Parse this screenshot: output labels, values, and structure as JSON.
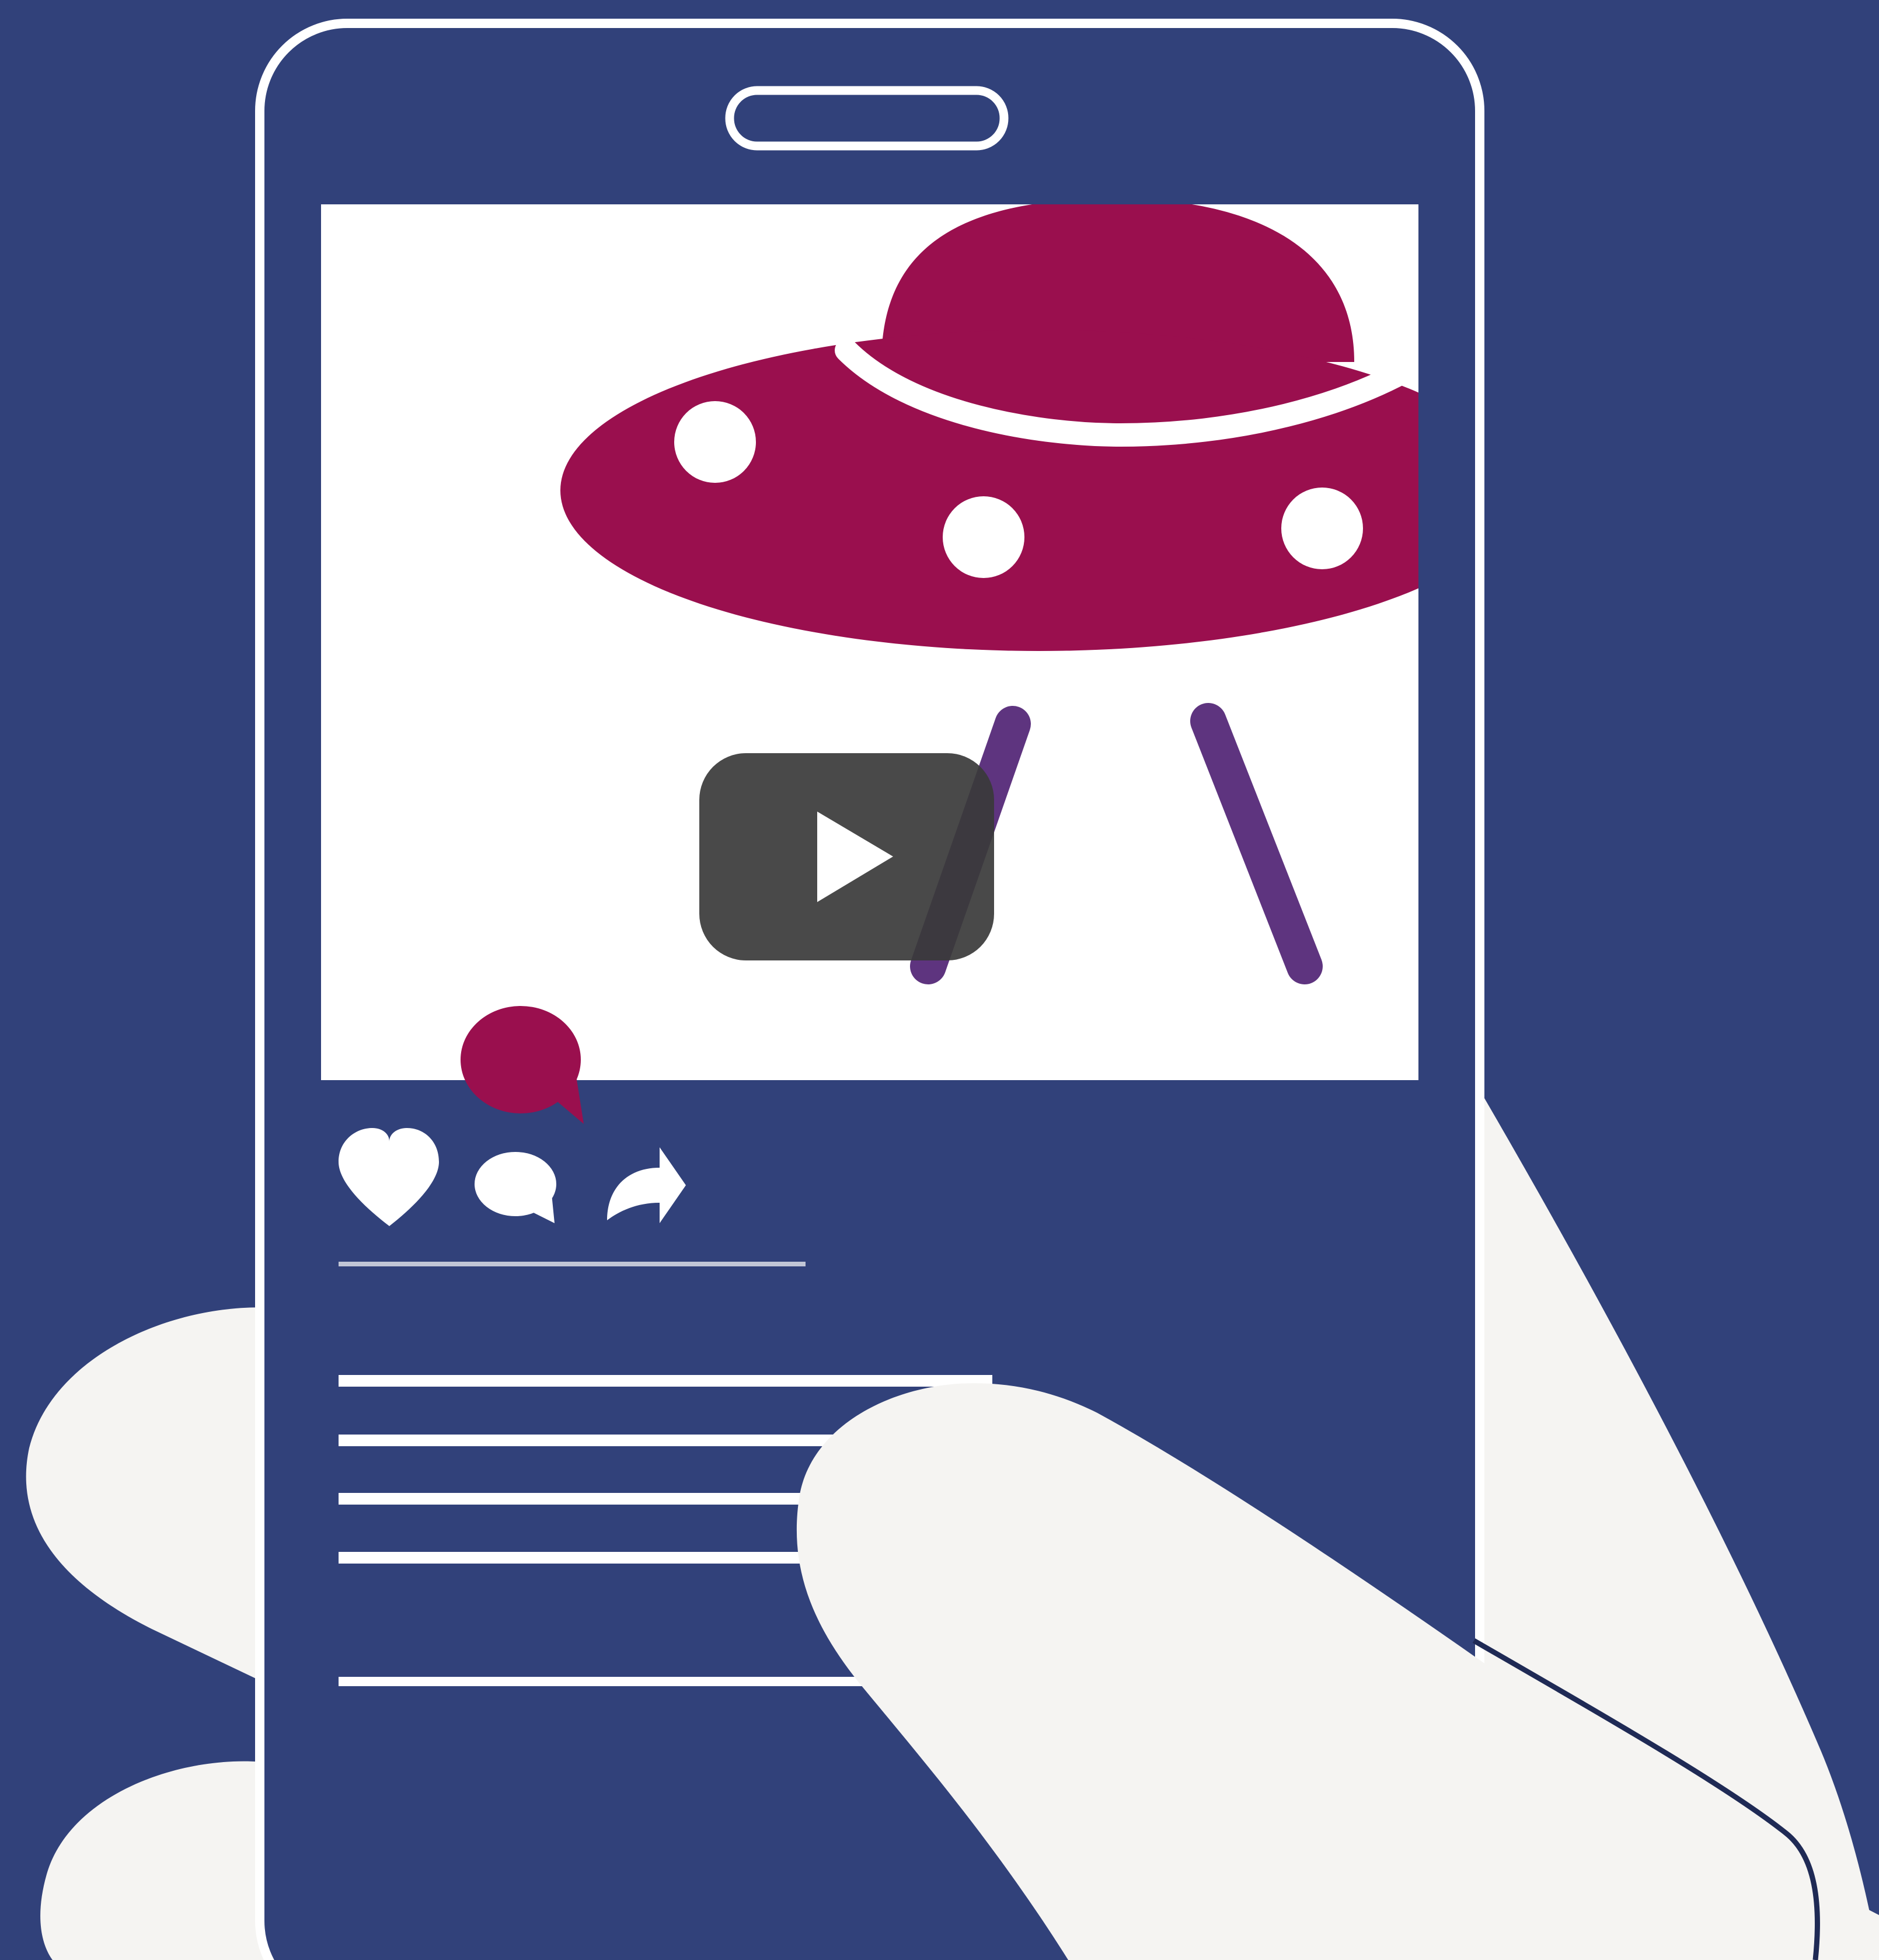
{
  "colors": {
    "background": "#31417a",
    "outline": "#ffffff",
    "hand": "#f5f4f2",
    "photo_background": "#ffffff",
    "ufo": "#9a0f4e",
    "ufo_legs": "#5e347f",
    "play_button": "#3a3a3a",
    "notification": "#9a0f4e"
  },
  "icons": {
    "phone_speaker": "speaker-slot-icon",
    "video_play": "play-icon",
    "notification": "chat-bubble-icon",
    "like": "heart-icon",
    "comment": "comment-icon",
    "share": "share-arrow-icon"
  }
}
